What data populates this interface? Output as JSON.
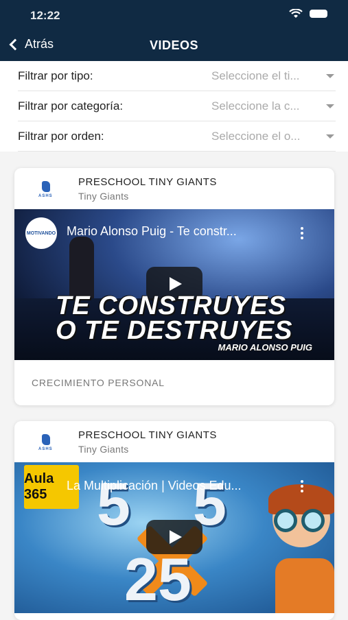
{
  "status_bar": {
    "time": "12:22"
  },
  "nav": {
    "back_label": "Atrás",
    "title": "VIDEOS"
  },
  "filters": [
    {
      "label": "Filtrar por tipo:",
      "placeholder": "Seleccione el ti..."
    },
    {
      "label": "Filtrar por categoría:",
      "placeholder": "Seleccione la c..."
    },
    {
      "label": "Filtrar por orden:",
      "placeholder": "Seleccione el o..."
    }
  ],
  "cards": [
    {
      "title": "PRESCHOOL TINY GIANTS",
      "subtitle": "Tiny Giants",
      "logo_text": "ASHS",
      "video_channel": "MOTIVANDO",
      "video_title": "Mario Alonso Puig - Te constr...",
      "video_overlay_line1": "TE CONSTRUYES",
      "video_overlay_line2": "O TE DESTRUYES",
      "video_overlay_name": "MARIO ALONSO PUIG",
      "category": "CRECIMIENTO PERSONAL"
    },
    {
      "title": "PRESCHOOL TINY GIANTS",
      "subtitle": "Tiny Giants",
      "logo_text": "ASHS",
      "video_channel": "Aula 365",
      "video_title": "La Multiplicación | Videos Edu...",
      "video_numbers": [
        "5",
        "5",
        "25"
      ]
    }
  ],
  "colors": {
    "header_bg": "#102a43",
    "card_bg": "#ffffff",
    "page_bg": "#f4f4f4"
  }
}
